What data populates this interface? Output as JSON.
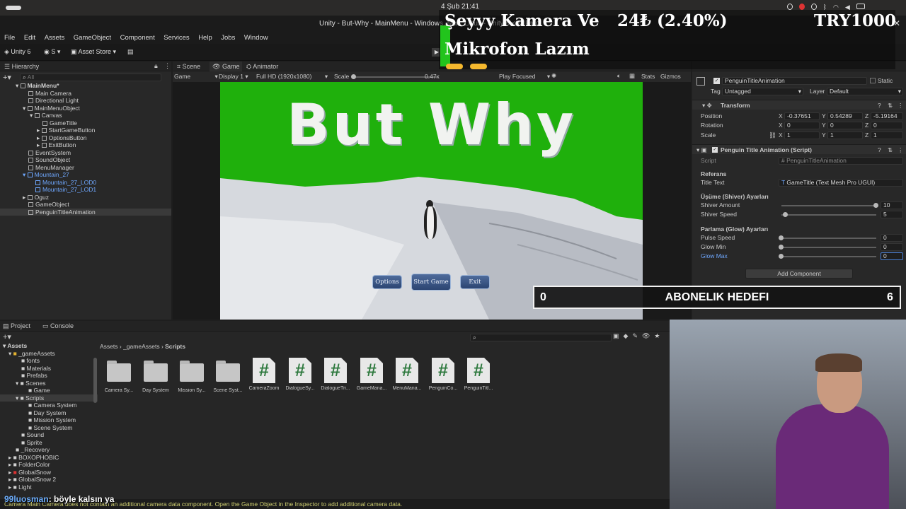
{
  "topbar": {
    "clock": "4 Şub  21:41"
  },
  "window": {
    "title": "Unity - But-Why - MainMenu - Windows, Mac, Linux - Unity 6 <Vulkan>"
  },
  "menu": [
    "File",
    "Edit",
    "Assets",
    "GameObject",
    "Component",
    "Services",
    "Help",
    "Jobs",
    "Window"
  ],
  "toolbar": {
    "unity": "Unity 6",
    "account": "S",
    "store": "Asset Store"
  },
  "hierarchy": {
    "tab": "Hierarchy",
    "search": "All",
    "items": [
      "MainMenu*",
      "Main Camera",
      "Directional Light",
      "MainMenuObject",
      "Canvas",
      "GameTitle",
      "StartGameButton",
      "OptionsButton",
      "ExitButton",
      "EventSystem",
      "SoundObject",
      "MenuManager",
      "Mountain_27",
      "Mountain_27_LOD0",
      "Mountain_27_LOD1",
      "Oguz",
      "GameObject",
      "PenguinTitleAnimation"
    ]
  },
  "tabs": {
    "scene": "Scene",
    "game": "Game",
    "animator": "Animator"
  },
  "gamebar": {
    "mode": "Game",
    "display": "Display 1",
    "res": "Full HD (1920x1080)",
    "scale_label": "Scale",
    "scale": "0.47x",
    "play": "Play Focused",
    "stats": "Stats",
    "gizmos": "Gizmos"
  },
  "game": {
    "title": "But Why",
    "options": "Options",
    "start": "Start Game",
    "exit": "Exit"
  },
  "inspector": {
    "name": "PenguinTitleAnimation",
    "static": "Static",
    "tag_label": "Tag",
    "tag": "Untagged",
    "layer_label": "Layer",
    "layer": "Default",
    "transform": "Transform",
    "position": [
      "-0.37651",
      "0.54289",
      "-5.19164"
    ],
    "rotation": [
      "0",
      "0",
      "0"
    ],
    "scale": [
      "1",
      "1",
      "1"
    ],
    "labels": {
      "position": "Position",
      "rotation": "Rotation",
      "scale": "Scale",
      "x": "X",
      "y": "Y",
      "z": "Z"
    },
    "component": "Penguin Title Animation (Script)",
    "script_label": "Script",
    "script": "PenguinTitleAnimation",
    "referans": "Referans",
    "title_text_label": "Title Text",
    "title_text": "GameTitle (Text Mesh Pro UGUI)",
    "shiver_header": "Üşüme (Shiver) Ayarları",
    "shiver_amount_label": "Shiver Amount",
    "shiver_amount": "10",
    "shiver_speed_label": "Shiver Speed",
    "shiver_speed": "5",
    "glow_header": "Parlama (Glow) Ayarları",
    "pulse_label": "Pulse Speed",
    "pulse": "0",
    "glowmin_label": "Glow Min",
    "glowmin": "0",
    "glowmax_label": "Glow Max",
    "glowmax": "0",
    "add_component": "Add Component"
  },
  "overlay": {
    "camera_line1": "Şeyyy Kamera Ve",
    "camera_line2": "Mikrofon Lazım",
    "currency": "24₺ (2.40%)",
    "goal_currency": "TRY1000",
    "sub_start": "0",
    "sub_label": "ABONELIK HEDEFI",
    "sub_end": "6",
    "chat_user": "99luosman",
    "chat_msg": ": böyle kalsın ya"
  },
  "project": {
    "tab_project": "Project",
    "tab_console": "Console",
    "breadcrumb": [
      "Assets",
      "_gameAssets",
      "Scripts"
    ],
    "tree": [
      "Assets",
      "_gameAssets",
      "fonts",
      "Materials",
      "Prefabs",
      "Scenes",
      "Game",
      "Scripts",
      "Camera System",
      "Day System",
      "Mission System",
      "Scene System",
      "Sound",
      "Sprite",
      "_Recovery",
      "BOXOPHOBIC",
      "FolderColor",
      "GlobalSnow",
      "GlobalSnow 2",
      "Light"
    ],
    "assets": [
      {
        "name": "Camera Sy...",
        "type": "folder"
      },
      {
        "name": "Day System",
        "type": "folder"
      },
      {
        "name": "Mission Sy...",
        "type": "folder"
      },
      {
        "name": "Scene Syst...",
        "type": "folder"
      },
      {
        "name": "CameraZoom",
        "type": "script"
      },
      {
        "name": "DialogueSy...",
        "type": "script"
      },
      {
        "name": "DialogueTri...",
        "type": "script"
      },
      {
        "name": "GameMana...",
        "type": "script"
      },
      {
        "name": "MenuMana...",
        "type": "script"
      },
      {
        "name": "PenguinCo...",
        "type": "script"
      },
      {
        "name": "PenguinTitl...",
        "type": "script"
      }
    ]
  },
  "statusbar": "Camera Main Camera does not contain an additional camera data component. Open the Game Object in the Inspector to add additional camera data."
}
